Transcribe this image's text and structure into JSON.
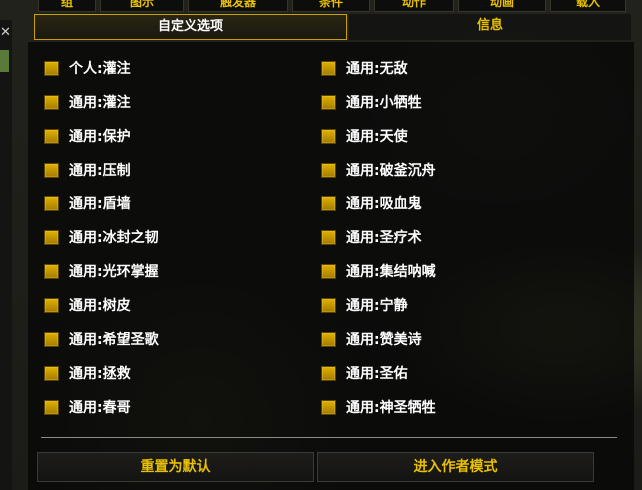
{
  "top_tabs": [
    "组",
    "图示",
    "触发器",
    "条件",
    "动作",
    "动画",
    "载入"
  ],
  "sub_tabs": {
    "custom_options": "自定义选项",
    "info": "信息"
  },
  "close_glyph": "✕",
  "options_left": [
    "个人:灌注",
    "通用:灌注",
    "通用:保护",
    "通用:压制",
    "通用:盾墙",
    "通用:冰封之韧",
    "通用:光环掌握",
    "通用:树皮",
    "通用:希望圣歌",
    "通用:拯救",
    "通用:春哥"
  ],
  "options_right": [
    "通用:无敌",
    "通用:小牺牲",
    "通用:天使",
    "通用:破釜沉舟",
    "通用:吸血鬼",
    "通用:圣疗术",
    "通用:集结呐喊",
    "通用:宁静",
    "通用:赞美诗",
    "通用:圣佑",
    "通用:神圣牺牲"
  ],
  "buttons": {
    "reset": "重置为默认",
    "author_mode": "进入作者模式"
  },
  "colors": {
    "accent": "#e8c000",
    "checkbox": "#d4a800",
    "text": "#ffffff"
  }
}
